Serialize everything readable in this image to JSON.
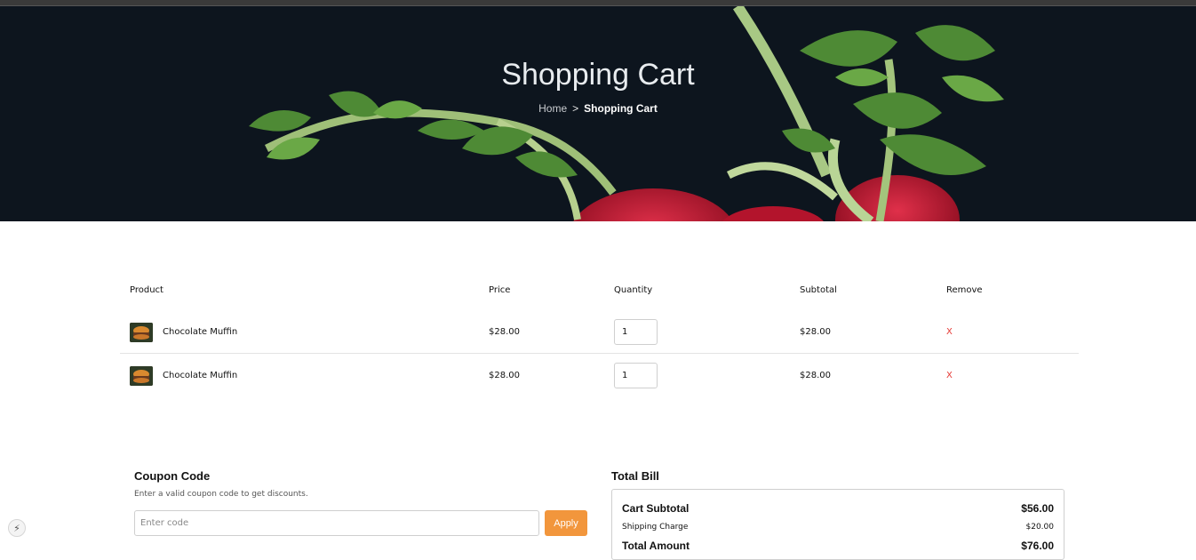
{
  "hero": {
    "title": "Shopping Cart",
    "breadcrumb": {
      "home": "Home",
      "separator": ">",
      "current": "Shopping Cart"
    }
  },
  "cart": {
    "headers": {
      "product": "Product",
      "price": "Price",
      "quantity": "Quantity",
      "subtotal": "Subtotal",
      "remove": "Remove"
    },
    "rows": [
      {
        "product": "Chocolate Muffin",
        "price": "$28.00",
        "quantity": "1",
        "subtotal": "$28.00",
        "remove": "X"
      },
      {
        "product": "Chocolate Muffin",
        "price": "$28.00",
        "quantity": "1",
        "subtotal": "$28.00",
        "remove": "X"
      }
    ]
  },
  "coupon": {
    "title": "Coupon Code",
    "hint": "Enter a valid coupon code to get discounts.",
    "placeholder": "Enter code",
    "apply_label": "Apply"
  },
  "bill": {
    "title": "Total Bill",
    "subtotal_label": "Cart Subtotal",
    "subtotal_value": "$56.00",
    "shipping_label": "Shipping Charge",
    "shipping_value": "$20.00",
    "total_label": "Total Amount",
    "total_value": "$76.00"
  },
  "colors": {
    "accent": "#f2963c",
    "remove": "#e53935",
    "hero_bg": "#0d151e"
  },
  "icons": {
    "fab": "bolt-icon"
  }
}
